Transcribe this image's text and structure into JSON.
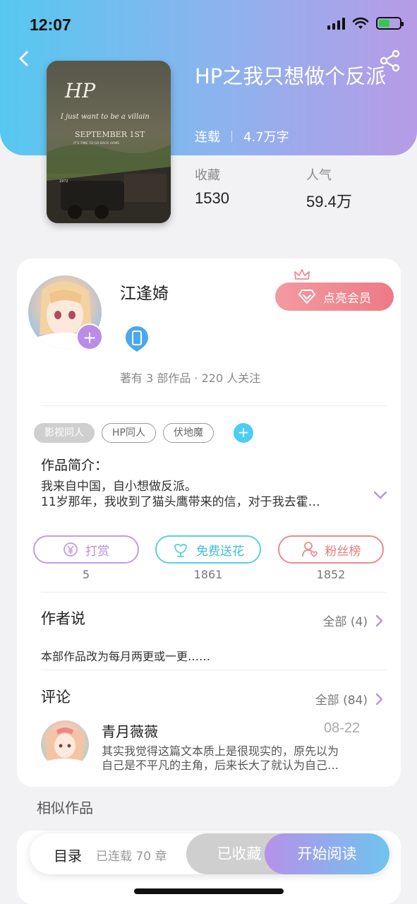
{
  "status_bar": {
    "time": "12:07",
    "icons": [
      "signal-icon",
      "wifi-icon",
      "battery-charging-icon"
    ],
    "battery_level": 0.55
  },
  "nav": {
    "back_icon": "chevron-left-icon",
    "share_icon": "share-icon"
  },
  "book": {
    "title": "HP之我只想做个反派",
    "status": "连载",
    "word_count": "4.7万字",
    "cover_text": {
      "line1": "HP",
      "line2": "I just want to be a villain",
      "line3": "SEPTEMBER 1ST",
      "line4": "IT'S TIME TO GO BACK HOME",
      "line5": "1972"
    },
    "stats": [
      {
        "label": "收藏",
        "value": "1530"
      },
      {
        "label": "人气",
        "value": "59.4万"
      }
    ]
  },
  "author": {
    "name": "江逢婍",
    "stats": "著有 3 部作品 · 220 人关注",
    "vip_button": "点亮会员",
    "follow_icon": "plus-icon",
    "badge_icon": "phone-badge-icon",
    "crown_icon": "crown-icon",
    "diamond_icon": "diamond-icon"
  },
  "tags": [
    "影视同人",
    "HP同人",
    "伏地魔"
  ],
  "intro": {
    "title": "作品简介：",
    "line1": "我来自中国，自小想做反派。",
    "line2": "11岁那年，我收到了猫头鹰带来的信，对于我去霍…"
  },
  "actions": [
    {
      "label": "打赏",
      "count": "5",
      "icon": "yen-coin-icon",
      "color": "#c49be8"
    },
    {
      "label": "免费送花",
      "count": "1861",
      "icon": "flower-icon",
      "color": "#5ccfe6"
    },
    {
      "label": "粉丝榜",
      "count": "1852",
      "icon": "user-heart-icon",
      "color": "#ee8a8a"
    }
  ],
  "author_says": {
    "title": "作者说",
    "link": "全部 (4)",
    "text": "本部作品改为每月两更或一更……"
  },
  "comments": {
    "title": "评论",
    "link": "全部 (84)",
    "items": [
      {
        "user": "青月薇薇",
        "date": "08-22",
        "line1": "其实我觉得这篇文本质上是很现实的，原先以为",
        "line2": "自己是不平凡的主角，后来长大了就认为自己…"
      }
    ]
  },
  "similar": {
    "title": "相似作品"
  },
  "bottom_bar": {
    "toc": "目录",
    "chapter_count": "已连载 70 章",
    "collected": "已收藏",
    "read": "开始阅读"
  }
}
